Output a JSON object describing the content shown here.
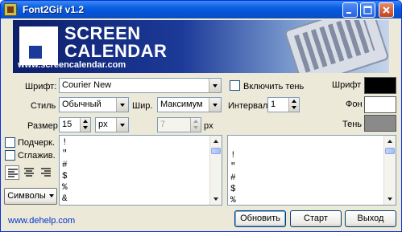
{
  "window": {
    "title": "Font2Gif v1.2",
    "buttons": [
      "minimize-icon",
      "maximize-icon",
      "close-icon"
    ]
  },
  "banner": {
    "line1": "SCREEN",
    "line2": "CALENDAR",
    "url": "www.screencalendar.com"
  },
  "font": {
    "label": "Шрифт:",
    "value": "Courier New"
  },
  "style": {
    "label": "Стиль",
    "value": "Обычный"
  },
  "width": {
    "label": "Шир.",
    "value": "Максимум"
  },
  "size": {
    "label": "Размер",
    "value": "15",
    "unit": "px"
  },
  "size2": {
    "value": "7",
    "unit": "px"
  },
  "transparent": {
    "label": "Включить тень",
    "checked": false
  },
  "interval": {
    "label": "Интервал",
    "value": "1"
  },
  "colors": {
    "font_label": "Шрифт",
    "font_color": "#000000",
    "bg_label": "Фон",
    "bg_color": "#ffffff",
    "shadow_label": "Тень",
    "shadow_color": "#808080"
  },
  "options": {
    "underline_label": "Подчерк.",
    "underline_checked": false,
    "smooth_label": "Сглажив.",
    "smooth_checked": false
  },
  "align": [
    "align-left-icon",
    "align-center-icon",
    "align-right-icon"
  ],
  "symbols_button": "Символы",
  "left_text": [
    "!",
    "\"",
    "#",
    "$",
    "%",
    "&"
  ],
  "right_text": [
    "!",
    "\"",
    "#",
    "$",
    "%"
  ],
  "footer": {
    "link": "www.dehelp.com",
    "refresh": "Обновить",
    "start": "Старт",
    "exit": "Выход"
  }
}
